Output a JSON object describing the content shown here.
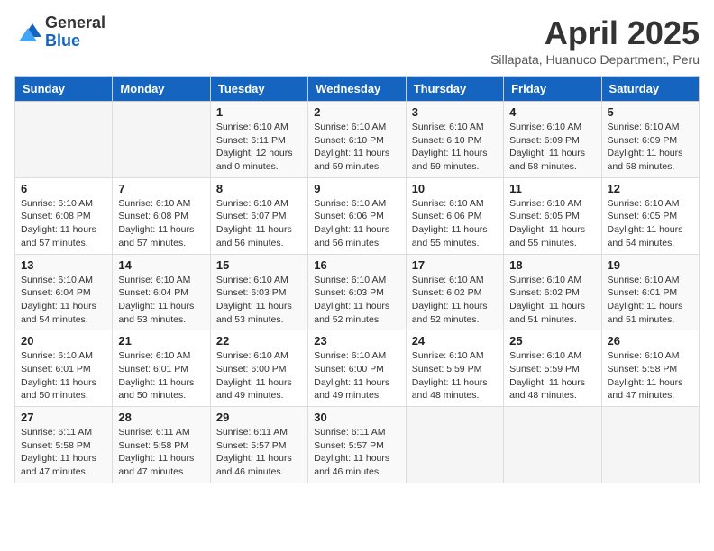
{
  "logo": {
    "general": "General",
    "blue": "Blue"
  },
  "title": "April 2025",
  "subtitle": "Sillapata, Huanuco Department, Peru",
  "days_header": [
    "Sunday",
    "Monday",
    "Tuesday",
    "Wednesday",
    "Thursday",
    "Friday",
    "Saturday"
  ],
  "weeks": [
    [
      {
        "day": "",
        "info": ""
      },
      {
        "day": "",
        "info": ""
      },
      {
        "day": "1",
        "info": "Sunrise: 6:10 AM\nSunset: 6:11 PM\nDaylight: 12 hours\nand 0 minutes."
      },
      {
        "day": "2",
        "info": "Sunrise: 6:10 AM\nSunset: 6:10 PM\nDaylight: 11 hours\nand 59 minutes."
      },
      {
        "day": "3",
        "info": "Sunrise: 6:10 AM\nSunset: 6:10 PM\nDaylight: 11 hours\nand 59 minutes."
      },
      {
        "day": "4",
        "info": "Sunrise: 6:10 AM\nSunset: 6:09 PM\nDaylight: 11 hours\nand 58 minutes."
      },
      {
        "day": "5",
        "info": "Sunrise: 6:10 AM\nSunset: 6:09 PM\nDaylight: 11 hours\nand 58 minutes."
      }
    ],
    [
      {
        "day": "6",
        "info": "Sunrise: 6:10 AM\nSunset: 6:08 PM\nDaylight: 11 hours\nand 57 minutes."
      },
      {
        "day": "7",
        "info": "Sunrise: 6:10 AM\nSunset: 6:08 PM\nDaylight: 11 hours\nand 57 minutes."
      },
      {
        "day": "8",
        "info": "Sunrise: 6:10 AM\nSunset: 6:07 PM\nDaylight: 11 hours\nand 56 minutes."
      },
      {
        "day": "9",
        "info": "Sunrise: 6:10 AM\nSunset: 6:06 PM\nDaylight: 11 hours\nand 56 minutes."
      },
      {
        "day": "10",
        "info": "Sunrise: 6:10 AM\nSunset: 6:06 PM\nDaylight: 11 hours\nand 55 minutes."
      },
      {
        "day": "11",
        "info": "Sunrise: 6:10 AM\nSunset: 6:05 PM\nDaylight: 11 hours\nand 55 minutes."
      },
      {
        "day": "12",
        "info": "Sunrise: 6:10 AM\nSunset: 6:05 PM\nDaylight: 11 hours\nand 54 minutes."
      }
    ],
    [
      {
        "day": "13",
        "info": "Sunrise: 6:10 AM\nSunset: 6:04 PM\nDaylight: 11 hours\nand 54 minutes."
      },
      {
        "day": "14",
        "info": "Sunrise: 6:10 AM\nSunset: 6:04 PM\nDaylight: 11 hours\nand 53 minutes."
      },
      {
        "day": "15",
        "info": "Sunrise: 6:10 AM\nSunset: 6:03 PM\nDaylight: 11 hours\nand 53 minutes."
      },
      {
        "day": "16",
        "info": "Sunrise: 6:10 AM\nSunset: 6:03 PM\nDaylight: 11 hours\nand 52 minutes."
      },
      {
        "day": "17",
        "info": "Sunrise: 6:10 AM\nSunset: 6:02 PM\nDaylight: 11 hours\nand 52 minutes."
      },
      {
        "day": "18",
        "info": "Sunrise: 6:10 AM\nSunset: 6:02 PM\nDaylight: 11 hours\nand 51 minutes."
      },
      {
        "day": "19",
        "info": "Sunrise: 6:10 AM\nSunset: 6:01 PM\nDaylight: 11 hours\nand 51 minutes."
      }
    ],
    [
      {
        "day": "20",
        "info": "Sunrise: 6:10 AM\nSunset: 6:01 PM\nDaylight: 11 hours\nand 50 minutes."
      },
      {
        "day": "21",
        "info": "Sunrise: 6:10 AM\nSunset: 6:01 PM\nDaylight: 11 hours\nand 50 minutes."
      },
      {
        "day": "22",
        "info": "Sunrise: 6:10 AM\nSunset: 6:00 PM\nDaylight: 11 hours\nand 49 minutes."
      },
      {
        "day": "23",
        "info": "Sunrise: 6:10 AM\nSunset: 6:00 PM\nDaylight: 11 hours\nand 49 minutes."
      },
      {
        "day": "24",
        "info": "Sunrise: 6:10 AM\nSunset: 5:59 PM\nDaylight: 11 hours\nand 48 minutes."
      },
      {
        "day": "25",
        "info": "Sunrise: 6:10 AM\nSunset: 5:59 PM\nDaylight: 11 hours\nand 48 minutes."
      },
      {
        "day": "26",
        "info": "Sunrise: 6:10 AM\nSunset: 5:58 PM\nDaylight: 11 hours\nand 47 minutes."
      }
    ],
    [
      {
        "day": "27",
        "info": "Sunrise: 6:11 AM\nSunset: 5:58 PM\nDaylight: 11 hours\nand 47 minutes."
      },
      {
        "day": "28",
        "info": "Sunrise: 6:11 AM\nSunset: 5:58 PM\nDaylight: 11 hours\nand 47 minutes."
      },
      {
        "day": "29",
        "info": "Sunrise: 6:11 AM\nSunset: 5:57 PM\nDaylight: 11 hours\nand 46 minutes."
      },
      {
        "day": "30",
        "info": "Sunrise: 6:11 AM\nSunset: 5:57 PM\nDaylight: 11 hours\nand 46 minutes."
      },
      {
        "day": "",
        "info": ""
      },
      {
        "day": "",
        "info": ""
      },
      {
        "day": "",
        "info": ""
      }
    ]
  ]
}
